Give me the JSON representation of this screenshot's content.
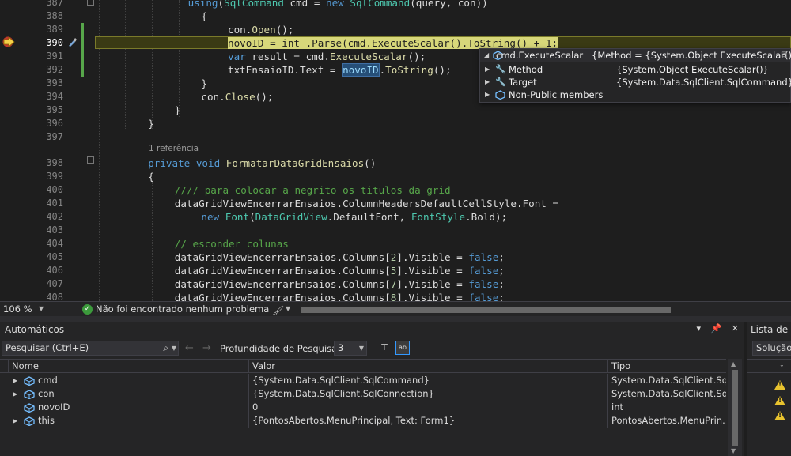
{
  "editor": {
    "lines": [
      {
        "n": "387",
        "segs": [
          [
            "kw",
            "using"
          ],
          [
            "",
            "("
          ],
          [
            "ty",
            "SqlCommand"
          ],
          [
            "",
            " cmd = "
          ],
          [
            "kw",
            "new"
          ],
          [
            "",
            " "
          ],
          [
            "ty",
            "SqlCommand"
          ],
          [
            "",
            "(query, con))"
          ]
        ]
      },
      {
        "n": "388",
        "segs": [
          [
            "",
            "{"
          ]
        ]
      },
      {
        "n": "389",
        "segs": [
          [
            "",
            "con."
          ],
          [
            "fn",
            "Open"
          ],
          [
            "",
            "();"
          ]
        ]
      },
      {
        "n": "390",
        "segs": [
          [
            "",
            "novoID = "
          ],
          [
            "kw",
            "int"
          ],
          [
            "",
            " .Parse(cmd.ExecuteScalar().ToString() + 1;"
          ]
        ]
      },
      {
        "n": "391",
        "segs": [
          [
            "kw",
            "var"
          ],
          [
            "",
            " result = cmd."
          ],
          [
            "fn",
            "ExecuteScalar"
          ],
          [
            "",
            "();"
          ]
        ]
      },
      {
        "n": "392",
        "segs": [
          [
            "",
            "txtEnsaioID.Text = "
          ],
          [
            "ref",
            "novoID"
          ],
          [
            "",
            "."
          ],
          [
            "fn",
            "ToString"
          ],
          [
            "",
            "();"
          ]
        ]
      },
      {
        "n": "393",
        "segs": [
          [
            "",
            "}"
          ]
        ]
      },
      {
        "n": "394",
        "segs": [
          [
            "",
            "con."
          ],
          [
            "fn",
            "Close"
          ],
          [
            "",
            "();"
          ]
        ]
      },
      {
        "n": "395",
        "segs": [
          [
            "",
            "}"
          ]
        ]
      },
      {
        "n": "396",
        "segs": [
          [
            "",
            "}"
          ]
        ]
      },
      {
        "n": "397",
        "segs": []
      },
      {
        "n": "398",
        "segs": [
          [
            "kw",
            "private void"
          ],
          [
            "",
            " "
          ],
          [
            "fn",
            "FormatarDataGridEnsaios"
          ],
          [
            "",
            "()"
          ]
        ]
      },
      {
        "n": "399",
        "segs": [
          [
            "",
            "{"
          ]
        ]
      },
      {
        "n": "400",
        "segs": [
          [
            "cm",
            "//// para colocar a negrito os titulos da grid"
          ]
        ]
      },
      {
        "n": "401",
        "segs": [
          [
            "",
            "dataGridViewEncerrarEnsaios.ColumnHeadersDefaultCellStyle.Font ="
          ]
        ]
      },
      {
        "n": "402",
        "segs": [
          [
            "kw",
            "new"
          ],
          [
            "",
            " "
          ],
          [
            "ty",
            "Font"
          ],
          [
            "",
            "("
          ],
          [
            "ty",
            "DataGridView"
          ],
          [
            "",
            ".DefaultFont, "
          ],
          [
            "ty",
            "FontStyle"
          ],
          [
            "",
            ".Bold);"
          ]
        ]
      },
      {
        "n": "403",
        "segs": []
      },
      {
        "n": "404",
        "segs": [
          [
            "cm",
            "// esconder colunas"
          ]
        ]
      },
      {
        "n": "405",
        "segs": [
          [
            "",
            "dataGridViewEncerrarEnsaios.Columns["
          ],
          [
            "nm",
            "2"
          ],
          [
            "",
            "].Visible = "
          ],
          [
            "kw",
            "false"
          ],
          [
            "",
            ";"
          ]
        ]
      },
      {
        "n": "406",
        "segs": [
          [
            "",
            "dataGridViewEncerrarEnsaios.Columns["
          ],
          [
            "nm",
            "5"
          ],
          [
            "",
            "].Visible = "
          ],
          [
            "kw",
            "false"
          ],
          [
            "",
            ";"
          ]
        ]
      },
      {
        "n": "407",
        "segs": [
          [
            "",
            "dataGridViewEncerrarEnsaios.Columns["
          ],
          [
            "nm",
            "7"
          ],
          [
            "",
            "].Visible = "
          ],
          [
            "kw",
            "false"
          ],
          [
            "",
            ";"
          ]
        ]
      },
      {
        "n": "408",
        "segs": [
          [
            "",
            "dataGridViewEncerrarEnsaios.Columns["
          ],
          [
            "nm",
            "8"
          ],
          [
            "",
            "].Visible = "
          ],
          [
            "kw",
            "false"
          ],
          [
            "",
            ";"
          ]
        ]
      }
    ],
    "reference_count": "1 referência"
  },
  "datatip": {
    "header_name": "cmd.ExecuteScalar",
    "header_value": "{Method = {System.Object ExecuteScalar()}}",
    "rows": [
      {
        "name": "Method",
        "value": "{System.Object ExecuteScalar()}",
        "icon": "wrench-icon"
      },
      {
        "name": "Target",
        "value": "{System.Data.SqlClient.SqlCommand}",
        "icon": "wrench-icon"
      },
      {
        "name": "Non-Public members",
        "value": "",
        "icon": "object-icon"
      }
    ]
  },
  "status": {
    "zoom": "106 %",
    "issues": "Não foi encontrado nenhum problema"
  },
  "autos": {
    "title": "Automáticos",
    "search_placeholder": "Pesquisar (Ctrl+E)",
    "depth_label": "Profundidade de Pesquisa:",
    "depth_value": "3",
    "columns": {
      "name": "Nome",
      "value": "Valor",
      "type": "Tipo"
    },
    "rows": [
      {
        "name": "cmd",
        "value": "{System.Data.SqlClient.SqlCommand}",
        "type": "System.Data.SqlClient.Sql...",
        "expandable": true
      },
      {
        "name": "con",
        "value": "{System.Data.SqlClient.SqlConnection}",
        "type": "System.Data.SqlClient.Sql...",
        "expandable": true
      },
      {
        "name": "novoID",
        "value": "0",
        "type": "int",
        "expandable": false
      },
      {
        "name": "this",
        "value": "{PontosAbertos.MenuPrincipal, Text: Form1}",
        "type": "PontosAbertos.MenuPrin...",
        "expandable": true
      }
    ]
  },
  "errors": {
    "title": "Lista de Erros",
    "scope": "Solução"
  },
  "colors": {
    "editor_bg": "#1e1e1e",
    "keyword": "#569cd6",
    "type": "#4ec9b0",
    "method": "#dcdcaa",
    "comment": "#57a64a",
    "warning": "#e8c32e"
  }
}
